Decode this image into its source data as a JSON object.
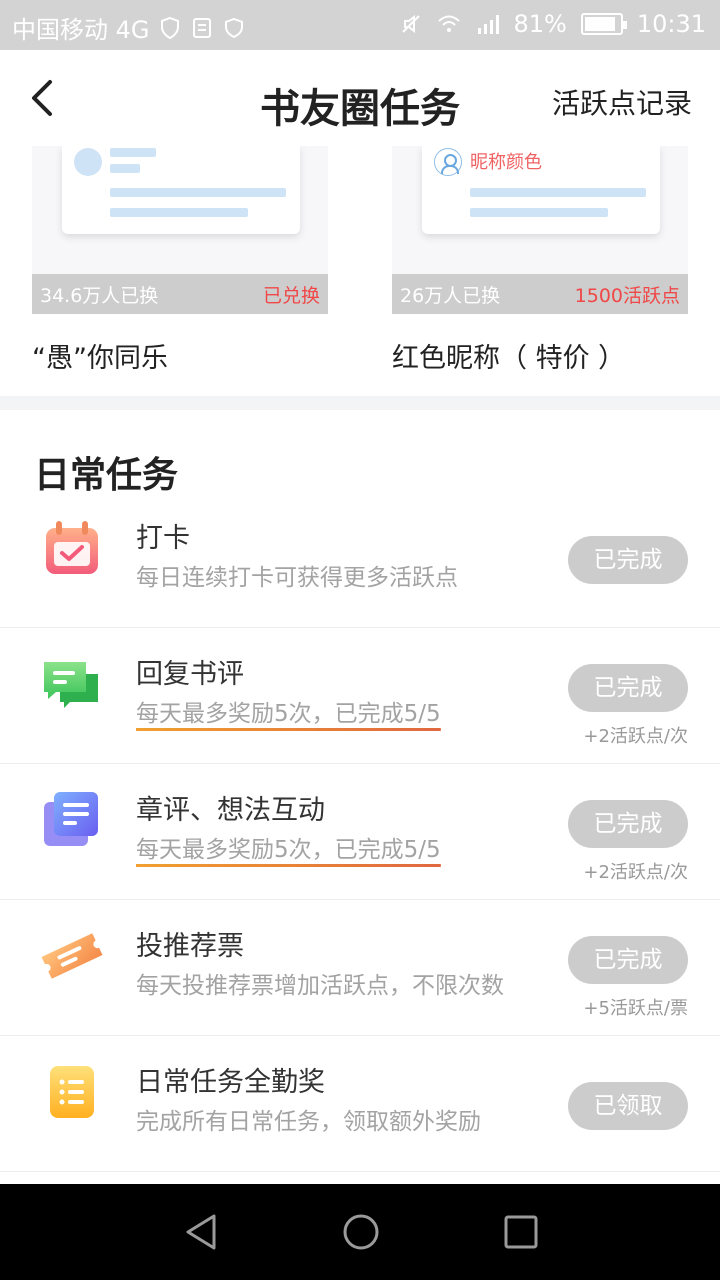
{
  "status_bar": {
    "carrier": "中国移动 4G",
    "battery": "81%",
    "time": "10:31"
  },
  "header": {
    "title": "书友圈任务",
    "record_link": "活跃点记录"
  },
  "rewards": [
    {
      "count": "34.6万人已换",
      "status": "已兑换",
      "name": "“愚”你同乐"
    },
    {
      "count": "26万人已换",
      "status": "1500活跃点",
      "name": "红色昵称（ 特价 ）",
      "preview_label": "昵称颜色"
    }
  ],
  "daily": {
    "title": "日常任务",
    "tasks": [
      {
        "name": "打卡",
        "desc": "每日连续打卡可获得更多活跃点",
        "button": "已完成",
        "reward": "",
        "icon": "calendar-icon"
      },
      {
        "name": "回复书评",
        "desc": "每天最多奖励5次，已完成5/5",
        "button": "已完成",
        "reward": "+2活跃点/次",
        "icon": "chat-icon"
      },
      {
        "name": "章评、想法互动",
        "desc": "每天最多奖励5次，已完成5/5",
        "button": "已完成",
        "reward": "+2活跃点/次",
        "icon": "note-icon"
      },
      {
        "name": "投推荐票",
        "desc": "每天投推荐票增加活跃点，不限次数",
        "button": "已完成",
        "reward": "+5活跃点/票",
        "icon": "ticket-icon"
      },
      {
        "name": "日常任务全勤奖",
        "desc": "完成所有日常任务，领取额外奖励",
        "button": "已领取",
        "reward": "",
        "icon": "list-icon"
      }
    ]
  },
  "colors": {
    "accent_red": "#f04848",
    "button_disabled": "#cccccc",
    "underline_start": "#f0a030",
    "underline_end": "#e06840"
  }
}
